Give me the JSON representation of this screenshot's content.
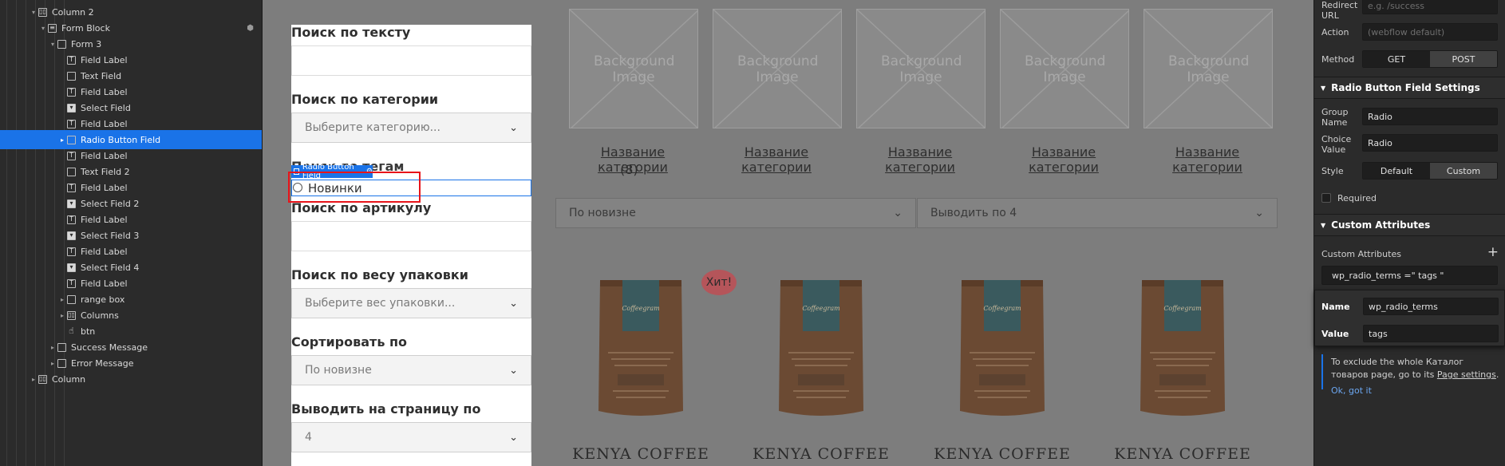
{
  "navigator": {
    "items": [
      {
        "label": "Column 2",
        "icon": "columns-icon",
        "toggle": "▾"
      },
      {
        "label": "Form Block",
        "icon": "form-block-icon",
        "toggle": "▾"
      },
      {
        "label": "Form 3",
        "icon": "form-icon",
        "toggle": "▾"
      },
      {
        "label": "Field Label",
        "icon": "field-label-icon",
        "toggle": ""
      },
      {
        "label": "Text Field",
        "icon": "text-field-icon",
        "toggle": ""
      },
      {
        "label": "Field Label",
        "icon": "field-label-icon",
        "toggle": ""
      },
      {
        "label": "Select Field",
        "icon": "select-field-icon",
        "toggle": ""
      },
      {
        "label": "Field Label",
        "icon": "field-label-icon",
        "toggle": ""
      },
      {
        "label": "Radio Button Field",
        "icon": "radio-field-icon",
        "toggle": "▸",
        "selected": true
      },
      {
        "label": "Field Label",
        "icon": "field-label-icon",
        "toggle": ""
      },
      {
        "label": "Text Field 2",
        "icon": "text-field-icon",
        "toggle": ""
      },
      {
        "label": "Field Label",
        "icon": "field-label-icon",
        "toggle": ""
      },
      {
        "label": "Select Field 2",
        "icon": "select-field-icon",
        "toggle": ""
      },
      {
        "label": "Field Label",
        "icon": "field-label-icon",
        "toggle": ""
      },
      {
        "label": "Select Field 3",
        "icon": "select-field-icon",
        "toggle": ""
      },
      {
        "label": "Field Label",
        "icon": "field-label-icon",
        "toggle": ""
      },
      {
        "label": "Select Field 4",
        "icon": "select-field-icon",
        "toggle": ""
      },
      {
        "label": "Field Label",
        "icon": "field-label-icon",
        "toggle": ""
      },
      {
        "label": "range box",
        "icon": "div-block-icon",
        "toggle": "▸"
      },
      {
        "label": "Columns",
        "icon": "columns-icon",
        "toggle": "▸"
      },
      {
        "label": "btn",
        "icon": "hand-icon",
        "toggle": ""
      },
      {
        "label": "Success Message",
        "icon": "div-block-icon",
        "toggle": "▸"
      },
      {
        "label": "Error Message",
        "icon": "div-block-icon",
        "toggle": "▸"
      },
      {
        "label": "Column",
        "icon": "columns-icon",
        "toggle": "▸"
      }
    ]
  },
  "form": {
    "search_text_label": "Поиск по тексту",
    "category_label": "Поиск по категории",
    "category_select": "Выберите категорию...",
    "terms_label": "Поиск по тегам",
    "radio_option": "Новинки",
    "sku_label": "Поиск по артикулу",
    "weight_label": "Поиск по весу упаковки",
    "weight_select": "Выберите вес упаковки...",
    "sort_label": "Сортировать по",
    "sort_select": "По новизне",
    "perpage_label": "Выводить на страницу по",
    "perpage_select": "4"
  },
  "selection_tag": "Radio Button Field",
  "categories": [
    {
      "image_label": "Background Image",
      "name": "Название категории",
      "count": "(8)"
    },
    {
      "image_label": "Background Image",
      "name": "Название категории",
      "count": ""
    },
    {
      "image_label": "Background Image",
      "name": "Название категории",
      "count": ""
    },
    {
      "image_label": "Background Image",
      "name": "Название категории",
      "count": ""
    },
    {
      "image_label": "Background Image",
      "name": "Название категории",
      "count": ""
    }
  ],
  "toolbar": {
    "sort_select": "По новизне",
    "perpage_select": "Выводить по 4"
  },
  "products": [
    {
      "name": "KENYA COFFEE",
      "badge": "Хит!"
    },
    {
      "name": "KENYA COFFEE",
      "badge": ""
    },
    {
      "name": "KENYA COFFEE",
      "badge": ""
    },
    {
      "name": "KENYA COFFEE",
      "badge": ""
    }
  ],
  "panel": {
    "redirect_label": "Redirect URL",
    "redirect_placeholder": "e.g. /success",
    "action_label": "Action",
    "action_placeholder": "(webflow default)",
    "method_label": "Method",
    "method_get": "GET",
    "method_post": "POST",
    "radio_settings_title": "Radio Button Field Settings",
    "group_name_label": "Group Name",
    "group_name_value": "Radio",
    "choice_value_label": "Choice Value",
    "choice_value_value": "Radio",
    "style_label": "Style",
    "style_default": "Default",
    "style_custom": "Custom",
    "required_label": "Required",
    "custom_attrs_title": "Custom Attributes",
    "custom_attrs_label": "Custom Attributes",
    "attr_summary": "wp_radio_terms =\" tags \"",
    "name_label": "Name",
    "name_value": "wp_radio_terms",
    "value_label": "Value",
    "value_value": "tags",
    "info_text_1": "To exclude the whole Каталог товаров page, go to its ",
    "info_link": "Page settings",
    "info_ok": "Ok, got it"
  },
  "colors": {
    "accent": "#1a73e8",
    "highlight_red": "#e8141a",
    "canvas_bg": "#7d7d7d",
    "panel_bg": "#2b2b2b"
  }
}
